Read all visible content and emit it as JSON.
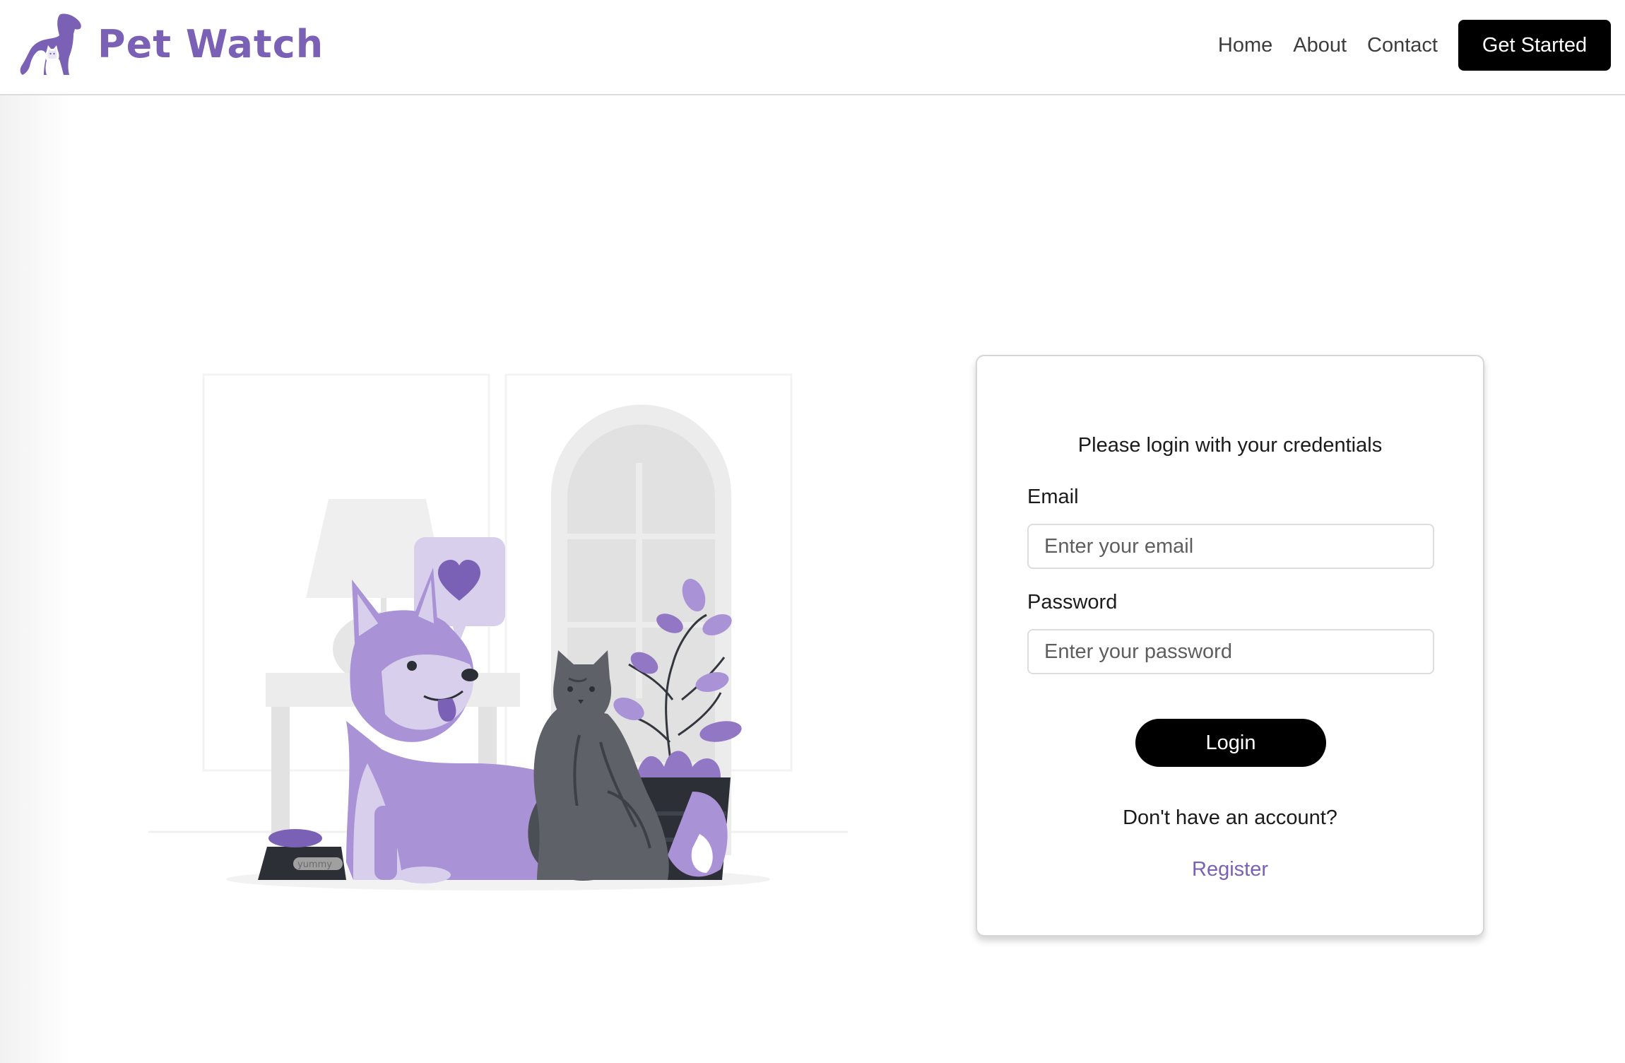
{
  "header": {
    "brand_name": "Pet Watch",
    "logo_icon": "dog-and-cat-silhouette-icon",
    "nav_links": [
      "Home",
      "About",
      "Contact"
    ],
    "cta_label": "Get Started"
  },
  "illustration": {
    "heart_icon": "heart-icon",
    "bowl_label": "yummy"
  },
  "login": {
    "subtitle": "Please login with your credentials",
    "email_label": "Email",
    "email_placeholder": "Enter your email",
    "email_value": "",
    "password_label": "Password",
    "password_placeholder": "Enter your password",
    "password_value": "",
    "login_label": "Login",
    "no_account_text": "Don't have an account?",
    "register_label": "Register"
  },
  "colors": {
    "brand_purple": "#7b61b5",
    "button_black": "#000000",
    "light_purple": "#a993d6",
    "pale_purple": "#d8cfec"
  }
}
